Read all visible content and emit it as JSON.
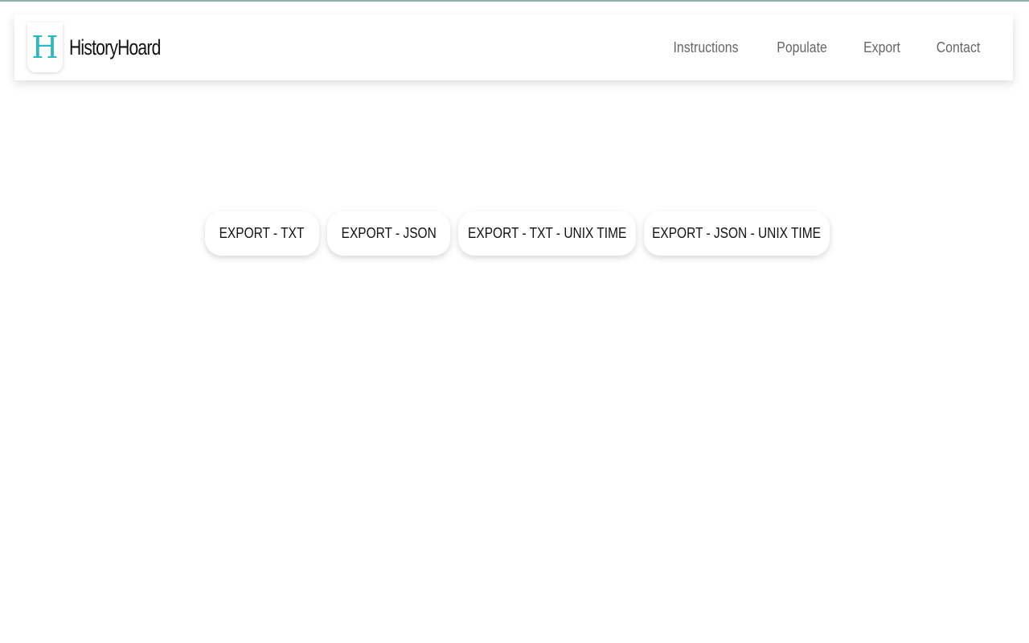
{
  "header": {
    "logo_letter": "H",
    "brand_name": "HistoryHoard",
    "nav": [
      {
        "label": "Instructions"
      },
      {
        "label": "Populate"
      },
      {
        "label": "Export"
      },
      {
        "label": "Contact"
      }
    ]
  },
  "main": {
    "export_buttons": [
      {
        "label": "EXPORT - TXT"
      },
      {
        "label": "EXPORT - JSON"
      },
      {
        "label": "EXPORT - TXT - UNIX TIME"
      },
      {
        "label": "EXPORT - JSON - UNIX TIME"
      }
    ]
  },
  "colors": {
    "accent": "#2bb7c4",
    "top_border": "#8fb3b0",
    "nav_text": "#666666"
  }
}
